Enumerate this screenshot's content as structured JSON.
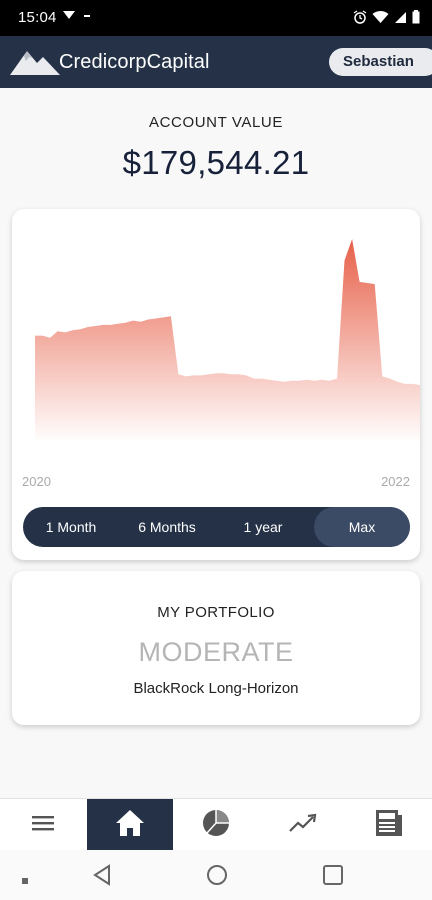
{
  "status_bar": {
    "time": "15:04",
    "left_icons": [
      "cast-icon",
      "dash-icon"
    ],
    "right_icons": [
      "alarm-icon",
      "wifi-icon",
      "signal-icon",
      "battery-icon"
    ]
  },
  "header": {
    "brand": "CredicorpCapital",
    "user": "Sebastian"
  },
  "account": {
    "label": "ACCOUNT VALUE",
    "value": "$179,544.21"
  },
  "chart_data": {
    "type": "area",
    "title": "",
    "xlabel": "",
    "ylabel": "",
    "x_ticks": [
      "2020",
      "2022"
    ],
    "series": [
      {
        "values": [
          100,
          100,
          98,
          104,
          103,
          105,
          106,
          108,
          109,
          110,
          110,
          111,
          112,
          114,
          113,
          115,
          116,
          117,
          118,
          64,
          62,
          63,
          63,
          64,
          65,
          65,
          64,
          64,
          63,
          60,
          60,
          59,
          58,
          57,
          58,
          58,
          59,
          58,
          59,
          58,
          60,
          170,
          190,
          150,
          149,
          148,
          62,
          60,
          57,
          55,
          55,
          54
        ]
      }
    ],
    "gradient": {
      "top": "#e76049",
      "bottom": "#ffffff"
    }
  },
  "ranges": [
    "1 Month",
    "6 Months",
    "1 year",
    "Max"
  ],
  "selected_range": "Max",
  "portfolio": {
    "title": "MY PORTFOLIO",
    "risk": "MODERATE",
    "fund": "BlackRock Long-Horizon"
  },
  "bottom_nav": [
    "menu-icon",
    "home-icon",
    "pie-chart-icon",
    "trend-icon",
    "news-icon"
  ],
  "active_nav": "home-icon",
  "colors": {
    "navy": "#243147",
    "accent": "#e76049"
  }
}
